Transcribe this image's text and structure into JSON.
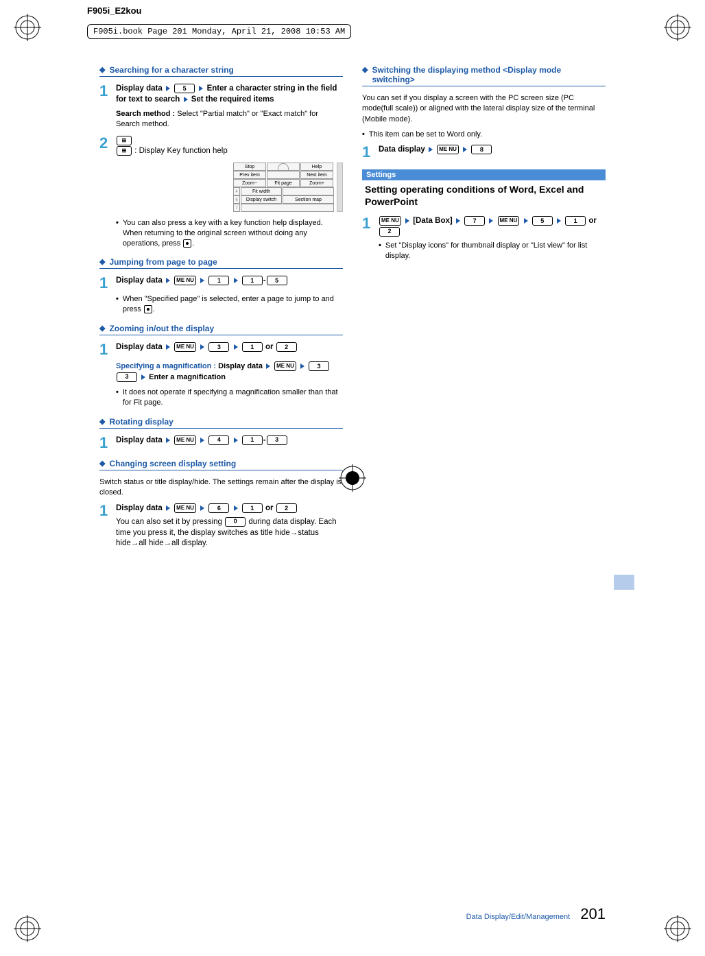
{
  "header": {
    "code": "F905i_E2kou",
    "path": "F905i.book  Page 201  Monday, April 21, 2008  10:53 AM"
  },
  "left": {
    "sec1": {
      "title": "Searching for a character string",
      "step1": {
        "line": "Display data",
        "key1": "5",
        "rest1": "Enter a character string in the field for text to search",
        "rest2": "Set the required items"
      },
      "search_label": "Search method :",
      "search_body": "Select \"Partial match\" or \"Exact match\" for Search method.",
      "step2_icon_key": "p",
      "step2_help": ": Display Key function help",
      "mini": {
        "r1a": "Stop",
        "r1b": "",
        "r1c": "Help",
        "r2a": "Prev item",
        "r2c": "Next item",
        "r3a": "Zoom−",
        "r3b": "Fit page",
        "r3c": "Zoom+",
        "lab4": "Fit width",
        "lab6a": "Display switch",
        "lab6b": "Section map"
      },
      "bullet1": "You can also press a key with a key function help displayed. When returning to the original screen without doing any operations, press "
    },
    "sec2": {
      "title": "Jumping from page to page",
      "step1_pre": "Display data",
      "step1_k1": "1",
      "step1_k2": "1",
      "step1_k3": "5",
      "bullet": "When \"Specified page\" is selected, enter a page to jump to and press "
    },
    "sec3": {
      "title": "Zooming in/out the display",
      "step1_pre": "Display data",
      "step1_k1": "3",
      "step1_k2": "1",
      "step1_or": "or",
      "step1_k3": "2",
      "spec_label": "Specifying a magnification :",
      "spec_pre": "Display data",
      "spec_k1": "3",
      "spec_k2": "3",
      "spec_post": "Enter a magnification",
      "bullet": "It does not operate if specifying a magnification smaller than that for Fit page."
    },
    "sec4": {
      "title": "Rotating display",
      "step1_pre": "Display data",
      "step1_k1": "4",
      "step1_k2": "1",
      "step1_k3": "3"
    },
    "sec5": {
      "title": "Changing screen display setting",
      "intro": "Switch status or title display/hide. The settings remain after the display is closed.",
      "step1_pre": "Display data",
      "step1_k1": "6",
      "step1_k2": "1",
      "step1_or": "or",
      "step1_k3": "2",
      "body1": "You can also set it by pressing ",
      "body1_k": "0",
      "body2": " during data display. Each time you press it, the display switches as title hide→status hide→all hide→all display."
    }
  },
  "right": {
    "sec6": {
      "title": "Switching the displaying method <Display mode switching>",
      "intro": "You can set if you display a screen with the PC screen size (PC mode(full scale)) or aligned with the lateral display size of the terminal (Mobile mode).",
      "bullet": "This item can be set to Word only.",
      "step1_pre": "Data display",
      "step1_k1": "8"
    },
    "settings": {
      "bar": "Settings",
      "title": "Setting operating conditions of Word, Excel and PowerPoint",
      "step1_pre": "[Data Box]",
      "k1": "7",
      "k2": "5",
      "k3": "1",
      "or": "or",
      "k4": "2",
      "bullet": "Set \"Display icons\" for thumbnail display or \"List view\" for list display."
    }
  },
  "footer": {
    "section": "Data Display/Edit/Management",
    "page": "201"
  },
  "icons": {
    "menu": "ME NU"
  }
}
